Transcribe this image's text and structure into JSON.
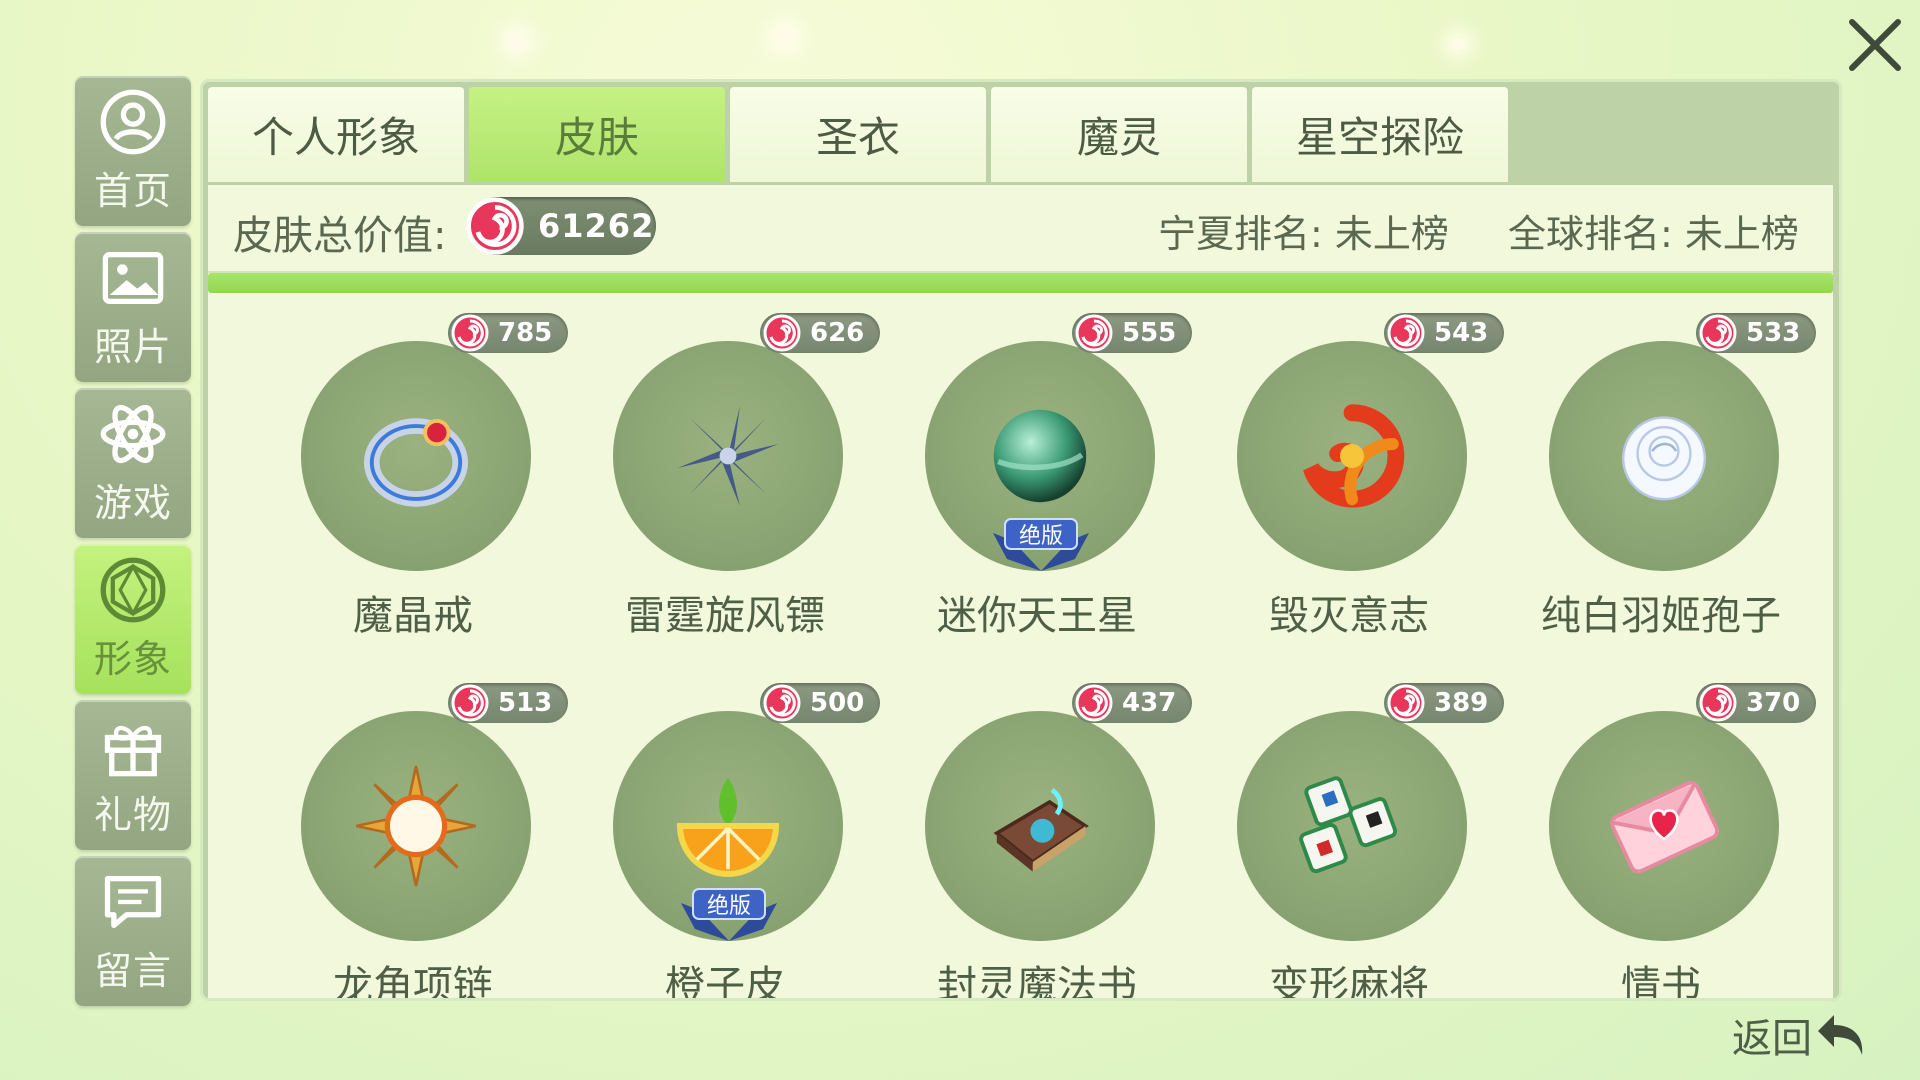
{
  "sidebar": {
    "items": [
      {
        "label": "首页",
        "icon": "home-icon"
      },
      {
        "label": "照片",
        "icon": "photo-icon"
      },
      {
        "label": "游戏",
        "icon": "atom-icon"
      },
      {
        "label": "形象",
        "icon": "hexagon-icon",
        "active": true
      },
      {
        "label": "礼物",
        "icon": "gift-icon"
      },
      {
        "label": "留言",
        "icon": "message-icon"
      }
    ]
  },
  "tabs": [
    {
      "label": "个人形象"
    },
    {
      "label": "皮肤",
      "active": true
    },
    {
      "label": "圣衣"
    },
    {
      "label": "魔灵"
    },
    {
      "label": "星空探险"
    }
  ],
  "stats": {
    "total_label": "皮肤总价值:",
    "total_value": "61262",
    "region_rank": "宁夏排名: 未上榜",
    "global_rank": "全球排名: 未上榜"
  },
  "items": [
    {
      "name": "魔晶戒",
      "price": "785",
      "icon": "ring-icon"
    },
    {
      "name": "雷霆旋风镖",
      "price": "626",
      "icon": "shuriken-icon"
    },
    {
      "name": "迷你天王星",
      "price": "555",
      "icon": "planet-icon",
      "badge": "绝版"
    },
    {
      "name": "毁灭意志",
      "price": "543",
      "icon": "swirl-icon"
    },
    {
      "name": "纯白羽姬孢子",
      "price": "533",
      "icon": "white-rose-icon"
    },
    {
      "name": "龙角项链",
      "price": "513",
      "icon": "sun-pendant-icon"
    },
    {
      "name": "橙子皮",
      "price": "500",
      "icon": "orange-slice-icon",
      "badge": "绝版"
    },
    {
      "name": "封灵魔法书",
      "price": "437",
      "icon": "spellbook-icon"
    },
    {
      "name": "变形麻将",
      "price": "389",
      "icon": "mahjong-icon"
    },
    {
      "name": "情书",
      "price": "370",
      "icon": "love-letter-icon"
    }
  ],
  "actions": {
    "back_label": "返回",
    "close_icon": "close-icon"
  }
}
